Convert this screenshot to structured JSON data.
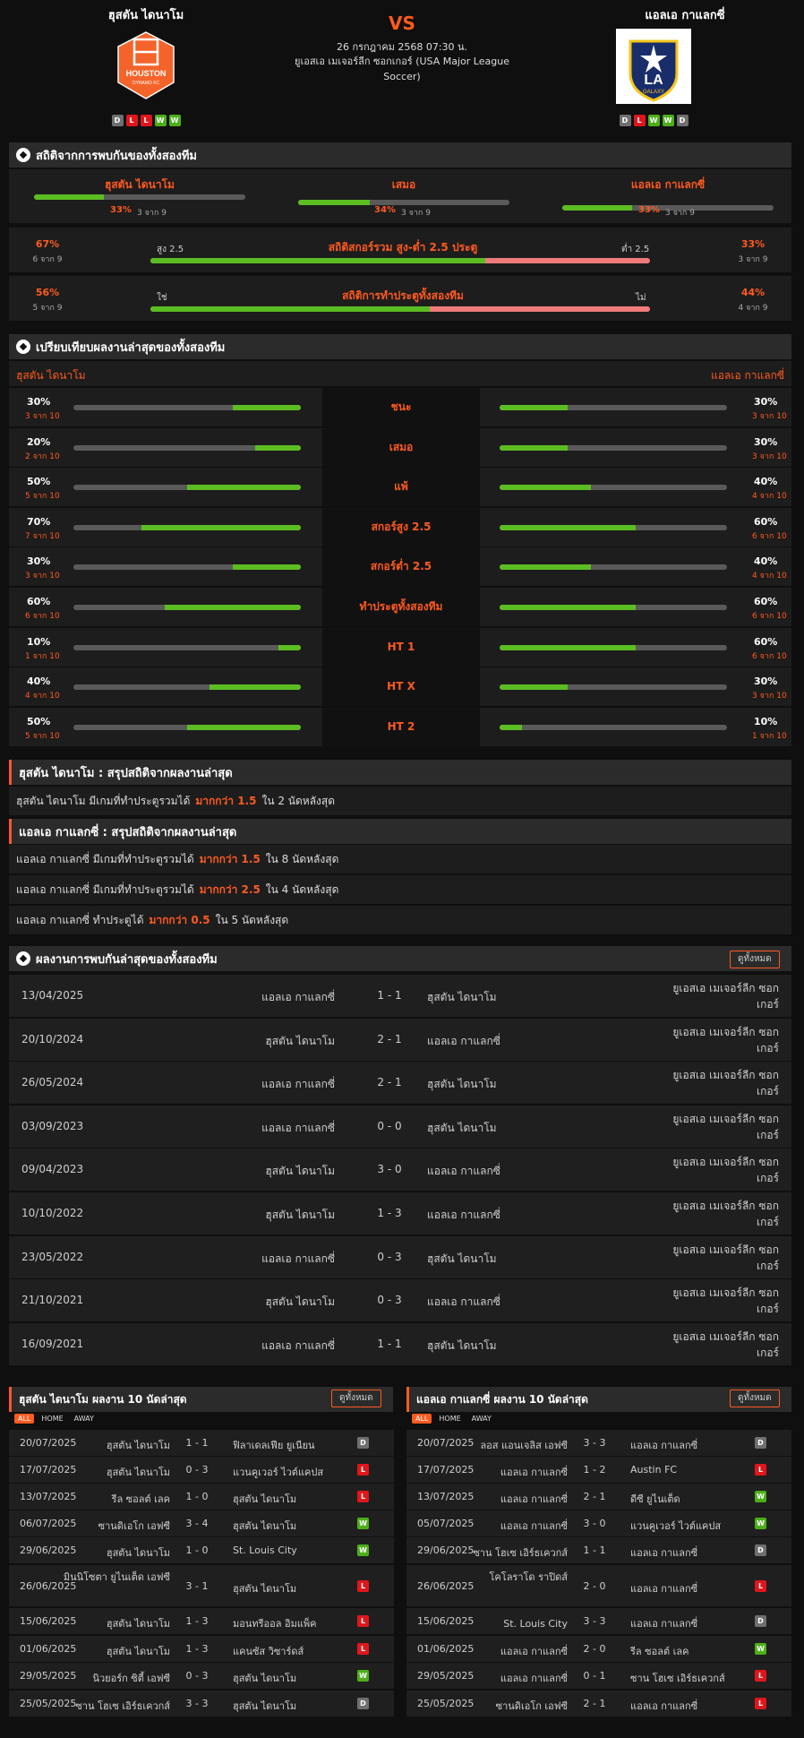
{
  "match": {
    "home": "ฮุสตัน ไดนาโม",
    "away": "แอลเอ กาแลกซี่",
    "vs": "VS",
    "date": "26 กรกฎาคม 2568 07:30 น.",
    "league": "ยูเอสเอ เมเจอร์ลีก ซอกเกอร์ (USA Major League Soccer)",
    "home_logo_text": "HOUSTON",
    "home_logo_sub": "DYNAMO FC",
    "away_logo_text": "LA",
    "away_logo_sub": "GALAXY",
    "home_form": [
      "D",
      "L",
      "L",
      "W",
      "W"
    ],
    "away_form": [
      "D",
      "L",
      "W",
      "W",
      "D"
    ]
  },
  "h2h_stats": {
    "title": "สถิติจากการพบกันของทั้งสองทีม",
    "cols": [
      {
        "name": "ฮุสตัน ไดนาโม",
        "pct": "33%",
        "of": "3 จาก 9",
        "fill": 0.33
      },
      {
        "name": "เสมอ",
        "pct": "34%",
        "of": "3 จาก 9",
        "fill": 0.34
      },
      {
        "name": "แอลเอ กาแลกซี่",
        "pct": "33%",
        "of": "3 จาก 9",
        "fill": 0.33
      }
    ],
    "ou": {
      "left_pct": "67%",
      "left_of": "6 จาก 9",
      "left_label": "สูง 2.5",
      "title": "สถิติสกอร์รวม สูง-ต่ำ 2.5 ประตู",
      "right_label": "ต่ำ 2.5",
      "right_pct": "33%",
      "right_of": "3 จาก 9",
      "fill": 0.67
    },
    "bt": {
      "left_pct": "56%",
      "left_of": "5 จาก 9",
      "left_label": "ใช่",
      "title": "สถิติการทำประตูทั้งสองทีม",
      "right_label": "ไม่",
      "right_pct": "44%",
      "right_of": "4 จาก 9",
      "fill": 0.56
    }
  },
  "compare": {
    "title": "เปรียบเทียบผลงานล่าสุดของทั้งสองทีม",
    "home": "ฮุสตัน ไดนาโม",
    "away": "แอลเอ กาแลกซี่",
    "rows": [
      {
        "label": "ชนะ",
        "hp": "30%",
        "ho": "3 จาก 10",
        "hf": 0.3,
        "ap": "30%",
        "ao": "3 จาก 10",
        "af": 0.3
      },
      {
        "label": "เสมอ",
        "hp": "20%",
        "ho": "2 จาก 10",
        "hf": 0.2,
        "ap": "30%",
        "ao": "3 จาก 10",
        "af": 0.3
      },
      {
        "label": "แพ้",
        "hp": "50%",
        "ho": "5 จาก 10",
        "hf": 0.5,
        "ap": "40%",
        "ao": "4 จาก 10",
        "af": 0.4
      },
      {
        "label": "สกอร์สูง 2.5",
        "hp": "70%",
        "ho": "7 จาก 10",
        "hf": 0.7,
        "ap": "60%",
        "ao": "6 จาก 10",
        "af": 0.6
      },
      {
        "label": "สกอร์ต่ำ 2.5",
        "hp": "30%",
        "ho": "3 จาก 10",
        "hf": 0.3,
        "ap": "40%",
        "ao": "4 จาก 10",
        "af": 0.4
      },
      {
        "label": "ทำประตูทั้งสองทีม",
        "hp": "60%",
        "ho": "6 จาก 10",
        "hf": 0.6,
        "ap": "60%",
        "ao": "6 จาก 10",
        "af": 0.6
      },
      {
        "label": "HT 1",
        "hp": "10%",
        "ho": "1 จาก 10",
        "hf": 0.1,
        "ap": "60%",
        "ao": "6 จาก 10",
        "af": 0.6
      },
      {
        "label": "HT X",
        "hp": "40%",
        "ho": "4 จาก 10",
        "hf": 0.4,
        "ap": "30%",
        "ao": "3 จาก 10",
        "af": 0.3
      },
      {
        "label": "HT 2",
        "hp": "50%",
        "ho": "5 จาก 10",
        "hf": 0.5,
        "ap": "10%",
        "ao": "1 จาก 10",
        "af": 0.1
      }
    ]
  },
  "summary_home": {
    "title": "ฮุสตัน ไดนาโม : สรุปสถิติจากผลงานล่าสุด",
    "lines": [
      {
        "pre": "ฮุสตัน ไดนาโม  มีเกมที่ทำประตูรวมได้",
        "hl": "มากกว่า  1.5",
        "post": "ใน 2 นัดหลังสุด"
      }
    ]
  },
  "summary_away": {
    "title": "แอลเอ กาแลกซี่ : สรุปสถิติจากผลงานล่าสุด",
    "lines": [
      {
        "pre": "แอลเอ กาแลกซี่  มีเกมที่ทำประตูรวมได้",
        "hl": "มากกว่า  1.5",
        "post": "ใน 8 นัดหลังสุด"
      },
      {
        "pre": "แอลเอ กาแลกซี่  มีเกมที่ทำประตูรวมได้",
        "hl": "มากกว่า  2.5",
        "post": "ใน 4 นัดหลังสุด"
      },
      {
        "pre": "แอลเอ กาแลกซี่  ทำประตูได้",
        "hl": "มากกว่า  0.5",
        "post": "ใน 5 นัดหลังสุด"
      }
    ]
  },
  "h2h": {
    "title": "ผลงานการพบกันล่าสุดของทั้งสองทีม",
    "see_all": "ดูทั้งหมด",
    "league_line1": "ยูเอสเอ เมเจอร์ลีก ซอก",
    "league_line2": "เกอร์",
    "rows": [
      {
        "date": "13/04/2025",
        "home": "แอลเอ กาแลกซี่",
        "score": "1 - 1",
        "away": "ฮุสตัน ไดนาโม"
      },
      {
        "date": "20/10/2024",
        "home": "ฮุสตัน ไดนาโม",
        "score": "2 - 1",
        "away": "แอลเอ กาแลกซี่"
      },
      {
        "date": "26/05/2024",
        "home": "แอลเอ กาแลกซี่",
        "score": "2 - 1",
        "away": "ฮุสตัน ไดนาโม"
      },
      {
        "date": "03/09/2023",
        "home": "แอลเอ กาแลกซี่",
        "score": "0 - 0",
        "away": "ฮุสตัน ไดนาโม"
      },
      {
        "date": "09/04/2023",
        "home": "ฮุสตัน ไดนาโม",
        "score": "3 - 0",
        "away": "แอลเอ กาแลกซี่"
      },
      {
        "date": "10/10/2022",
        "home": "ฮุสตัน ไดนาโม",
        "score": "1 - 3",
        "away": "แอลเอ กาแลกซี่"
      },
      {
        "date": "23/05/2022",
        "home": "แอลเอ กาแลกซี่",
        "score": "0 - 3",
        "away": "ฮุสตัน ไดนาโม"
      },
      {
        "date": "21/10/2021",
        "home": "ฮุสตัน ไดนาโม",
        "score": "0 - 3",
        "away": "แอลเอ กาแลกซี่"
      },
      {
        "date": "16/09/2021",
        "home": "แอลเอ กาแลกซี่",
        "score": "1 - 1",
        "away": "ฮุสตัน ไดนาโม"
      }
    ]
  },
  "last_home": {
    "title": "ฮุสตัน ไดนาโม ผลงาน 10 นัดล่าสุด",
    "see_all": "ดูทั้งหมด",
    "tabs": [
      "ALL",
      "HOME",
      "AWAY"
    ],
    "rows": [
      {
        "date": "20/07/2025",
        "home": "ฮุสตัน ไดนาโม",
        "score": "1 - 1",
        "away": "ฟิลาเดลเฟีย ยูเนียน",
        "res": "D"
      },
      {
        "date": "17/07/2025",
        "home": "ฮุสตัน ไดนาโม",
        "score": "0 - 3",
        "away": "แวนคูเวอร์ ไวต์แคปส",
        "res": "L"
      },
      {
        "date": "13/07/2025",
        "home": "รีล ซอลต์ เลค",
        "score": "1 - 0",
        "away": "ฮุสตัน ไดนาโม",
        "res": "L"
      },
      {
        "date": "06/07/2025",
        "home": "ซานดิเอโก เอฟซี",
        "score": "3 - 4",
        "away": "ฮุสตัน ไดนาโม",
        "res": "W"
      },
      {
        "date": "29/06/2025",
        "home": "ฮุสตัน ไดนาโม",
        "score": "1 - 0",
        "away": "St. Louis City",
        "res": "W"
      },
      {
        "date": "26/06/2025",
        "home": "มินนิโซตา ยูไนเต็ด เอฟซี",
        "score": "3 - 1",
        "away": "ฮุสตัน ไดนาโม",
        "res": "L"
      },
      {
        "date": "15/06/2025",
        "home": "ฮุสตัน ไดนาโม",
        "score": "1 - 3",
        "away": "มอนทรีออล อิมแพ็ค",
        "res": "L"
      },
      {
        "date": "01/06/2025",
        "home": "ฮุสตัน ไดนาโม",
        "score": "1 - 3",
        "away": "แคนซัส วิซาร์ดส์",
        "res": "L"
      },
      {
        "date": "29/05/2025",
        "home": "นิวยอร์ก ซิตี้ เอฟซี",
        "score": "0 - 3",
        "away": "ฮุสตัน ไดนาโม",
        "res": "W"
      },
      {
        "date": "25/05/2025",
        "home": "ซาน โฮเซ เอิร์ธเควกส์",
        "score": "3 - 3",
        "away": "ฮุสตัน ไดนาโม",
        "res": "D"
      }
    ]
  },
  "last_away": {
    "title": "แอลเอ กาแลกซี่ ผลงาน 10 นัดล่าสุด",
    "see_all": "ดูทั้งหมด",
    "tabs": [
      "ALL",
      "HOME",
      "AWAY"
    ],
    "rows": [
      {
        "date": "20/07/2025",
        "home": "ลอส แอนเจลิส เอฟซี",
        "score": "3 - 3",
        "away": "แอลเอ กาแลกซี่",
        "res": "D"
      },
      {
        "date": "17/07/2025",
        "home": "แอลเอ กาแลกซี่",
        "score": "1 - 2",
        "away": "Austin FC",
        "res": "L"
      },
      {
        "date": "13/07/2025",
        "home": "แอลเอ กาแลกซี่",
        "score": "2 - 1",
        "away": "ดีซี ยูไนเต็ด",
        "res": "W"
      },
      {
        "date": "05/07/2025",
        "home": "แอลเอ กาแลกซี่",
        "score": "3 - 0",
        "away": "แวนคูเวอร์ ไวต์แคปส",
        "res": "W"
      },
      {
        "date": "29/06/2025",
        "home": "ซาน โฮเซ เอิร์ธเควกส์",
        "score": "1 - 1",
        "away": "แอลเอ กาแลกซี่",
        "res": "D"
      },
      {
        "date": "26/06/2025",
        "home": "โคโลราโด ราปิดส์",
        "score": "2 - 0",
        "away": "แอลเอ กาแลกซี่",
        "res": "L"
      },
      {
        "date": "15/06/2025",
        "home": "St. Louis City",
        "score": "3 - 3",
        "away": "แอลเอ กาแลกซี่",
        "res": "D"
      },
      {
        "date": "01/06/2025",
        "home": "แอลเอ กาแลกซี่",
        "score": "2 - 0",
        "away": "รีล ซอลต์ เลค",
        "res": "W"
      },
      {
        "date": "29/05/2025",
        "home": "แอลเอ กาแลกซี่",
        "score": "0 - 1",
        "away": "ซาน โฮเซ เอิร์ธเควกส์",
        "res": "L"
      },
      {
        "date": "25/05/2025",
        "home": "ซานดิเอโก เอฟซี",
        "score": "2 - 1",
        "away": "แอลเอ กาแลกซี่",
        "res": "L"
      }
    ]
  },
  "colors": {
    "accent": "#ff5a1f",
    "win": "#4caf1a",
    "loss": "#e0161b",
    "draw": "#6f6f6f",
    "bar_green": "#5cbd22",
    "bar_red": "#f07b7b"
  }
}
